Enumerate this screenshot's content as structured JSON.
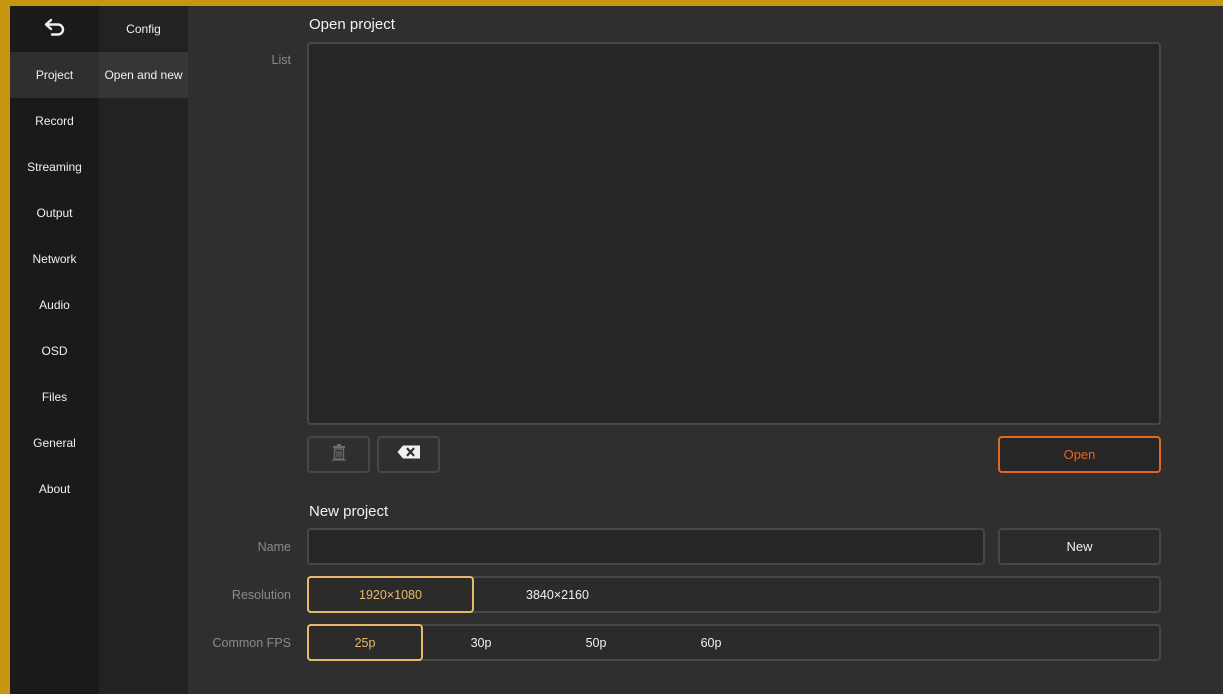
{
  "sidebar": {
    "back_icon": "back-arrow-icon",
    "items": [
      {
        "label": "Project",
        "active": true
      },
      {
        "label": "Record"
      },
      {
        "label": "Streaming"
      },
      {
        "label": "Output"
      },
      {
        "label": "Network"
      },
      {
        "label": "Audio"
      },
      {
        "label": "OSD"
      },
      {
        "label": "Files"
      },
      {
        "label": "General"
      },
      {
        "label": "About"
      }
    ]
  },
  "subnav": {
    "items": [
      {
        "label": "Config"
      },
      {
        "label": "Open and new",
        "active": true
      }
    ]
  },
  "open_project": {
    "title": "Open project",
    "list_label": "List",
    "delete_icon": "trash-icon",
    "clear_icon": "backspace-icon",
    "open_label": "Open"
  },
  "new_project": {
    "title": "New project",
    "name_label": "Name",
    "name_value": "",
    "new_label": "New",
    "resolution_label": "Resolution",
    "resolutions": [
      "1920×1080",
      "3840×2160"
    ],
    "resolution_selected": "1920×1080",
    "fps_label": "Common FPS",
    "fps_options": [
      "25p",
      "30p",
      "50p",
      "60p"
    ],
    "fps_selected": "25p"
  },
  "colors": {
    "frame_border": "#c9960f",
    "accent_orange": "#e4671f",
    "selected_outline": "#e8b96a"
  }
}
